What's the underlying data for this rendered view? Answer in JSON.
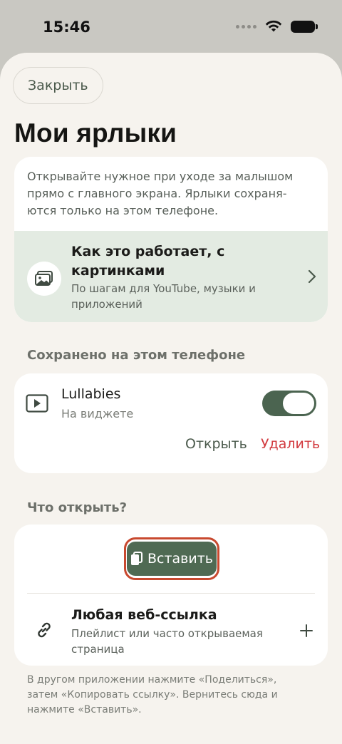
{
  "status_bar": {
    "time": "15:46"
  },
  "header": {
    "close_label": "Закрыть",
    "title": "Мои ярлыки"
  },
  "info": {
    "text": "Открывайте нужное при уходе за малышом прямо с главного экрана. Ярлыки сохраня-ются только на этом телефоне.",
    "how_title": "Как это работает, с картинками",
    "how_subtitle": "По шагам для YouTube, музыки и приложений"
  },
  "saved_section": {
    "label": "Сохранено на этом телефоне",
    "items": [
      {
        "title": "Lullabies",
        "subtitle": "На виджете",
        "widget_enabled": true,
        "open_label": "Открыть",
        "delete_label": "Удалить"
      }
    ]
  },
  "what_section": {
    "label": "Что открыть?",
    "paste_label": "Вставить",
    "link_title": "Любая веб-ссылка",
    "link_subtitle": "Плейлист или часто открываемая страница"
  },
  "footer": {
    "note": "В другом приложении нажмите «Поделиться», затем «Копировать ссылку». Вернитесь сюда и нажмите «Вставить»."
  },
  "colors": {
    "accent": "#4f6a53",
    "delete": "#d23a3f",
    "highlight": "#c8492f",
    "background": "#f6f3ee"
  }
}
